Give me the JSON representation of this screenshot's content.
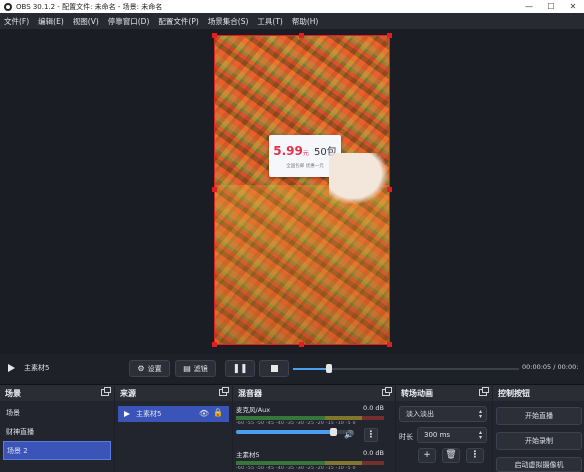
{
  "window": {
    "title": "OBS 30.1.2 - 配置文件: 未命名 - 场景: 未命名"
  },
  "menu": [
    "文件(F)",
    "编辑(E)",
    "视图(V)",
    "停靠窗口(D)",
    "配置文件(P)",
    "场景集合(S)",
    "工具(T)",
    "帮助(H)"
  ],
  "preview": {
    "price": "5.99",
    "price_unit": "元",
    "pack": "50包",
    "sub_text": "全国包邮  优惠一元"
  },
  "controls": {
    "current_source": "主素材5",
    "settings_label": "设置",
    "filters_label": "滤镜",
    "time": "00:00:05 / 00:00:",
    "progress_fraction": 0.16
  },
  "scenes": {
    "header": "场景",
    "items": [
      "场景",
      "财神直播",
      "场景 2"
    ],
    "active_index": 2
  },
  "sources": {
    "header": "来源",
    "items": [
      {
        "label": "主素材5"
      }
    ]
  },
  "mixer": {
    "header": "混音器",
    "channels": [
      {
        "name": "麦克风/Aux",
        "db": "0.0 dB",
        "scale": "-60 -55 -50 -45 -40 -35 -30 -25 -20 -15 -10 -5 0",
        "volume_fraction": 0.82
      },
      {
        "name": "主素材5",
        "db": "0.0 dB",
        "scale": "-60 -55 -50 -45 -40 -35 -30 -25 -20 -15 -10 -5 0"
      }
    ]
  },
  "transitions": {
    "header": "转场动画",
    "type": "淡入淡出",
    "duration_label": "时长",
    "duration": "300 ms"
  },
  "controls_dock": {
    "header": "控制按钮",
    "start_stream": "开始直播",
    "start_record": "开始录制",
    "virtual_cam": "启动虚拟摄像机"
  },
  "colors": {
    "accent": "#3a54b8",
    "selection": "#e02020",
    "meter_blue": "#4aa0f0"
  }
}
